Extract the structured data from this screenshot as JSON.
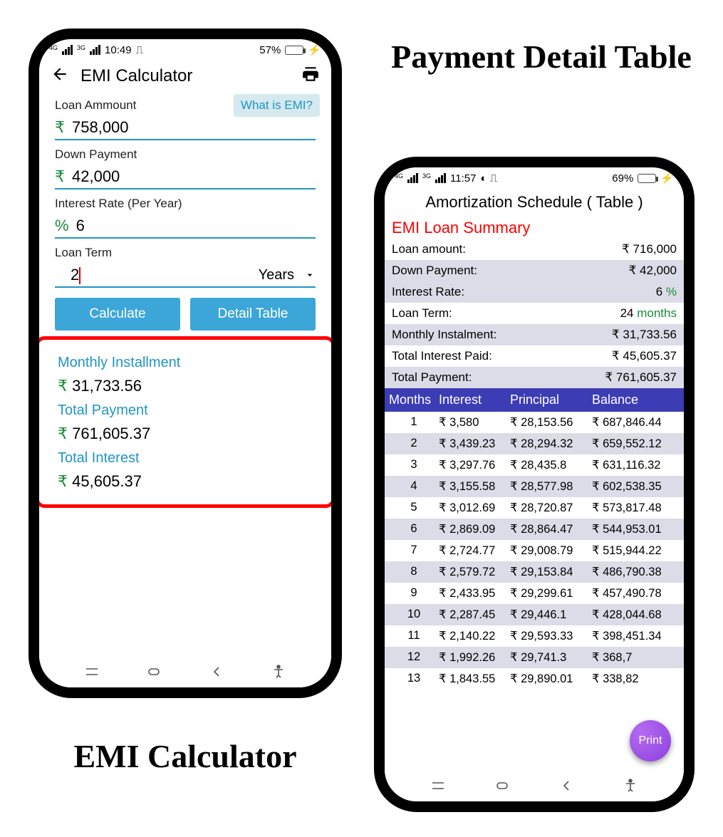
{
  "captions": {
    "right": "Payment Detail Table",
    "left": "EMI Calculator"
  },
  "phone1": {
    "status": {
      "time": "10:49",
      "net": "4G",
      "net2": "3G",
      "battery_pct": "57%",
      "battery_fill": 57
    },
    "appbar": {
      "title": "EMI Calculator"
    },
    "form": {
      "loan_label": "Loan Ammount",
      "what_is_emi": "What is EMI?",
      "loan_value": "758,000",
      "down_label": "Down Payment",
      "down_value": "42,000",
      "rate_label": "Interest Rate (Per Year)",
      "rate_value": "6",
      "term_label": "Loan Term",
      "term_value": "2",
      "term_unit": "Years",
      "rupee": "₹",
      "percent": "%"
    },
    "buttons": {
      "calculate": "Calculate",
      "detail": "Detail Table"
    },
    "results": {
      "mi_label": "Monthly Installment",
      "mi_value": "31,733.56",
      "tp_label": "Total Payment",
      "tp_value": "761,605.37",
      "ti_label": "Total Interest",
      "ti_value": "45,605.37",
      "rupee": "₹"
    }
  },
  "phone2": {
    "status": {
      "time": "11:57",
      "net": "4G",
      "net2": "3G",
      "battery_pct": "69%",
      "battery_fill": 69
    },
    "title": "Amortization Schedule ( Table )",
    "summary_title": "EMI Loan Summary",
    "summary": {
      "loan_l": "Loan amount:",
      "loan_v": "₹ 716,000",
      "dp_l": "Down Payment:",
      "dp_v": "₹ 42,000",
      "rate_l": "Interest Rate:",
      "rate_v": "6",
      "rate_u": " %",
      "term_l": "Loan Term:",
      "term_v": "24",
      "term_u": " months",
      "mi_l": "Monthly Instalment:",
      "mi_v": "₹ 31,733.56",
      "tip_l": "Total Interest Paid:",
      "tip_v": "₹ 45,605.37",
      "tp_l": "Total Payment:",
      "tp_v": "₹ 761,605.37"
    },
    "table": {
      "headers": {
        "m": "Months",
        "i": "Interest",
        "p": "Principal",
        "b": "Balance"
      },
      "rows": [
        {
          "m": "1",
          "i": "₹ 3,580",
          "p": "₹ 28,153.56",
          "b": "₹ 687,846.44"
        },
        {
          "m": "2",
          "i": "₹ 3,439.23",
          "p": "₹ 28,294.32",
          "b": "₹ 659,552.12"
        },
        {
          "m": "3",
          "i": "₹ 3,297.76",
          "p": "₹ 28,435.8",
          "b": "₹ 631,116.32"
        },
        {
          "m": "4",
          "i": "₹ 3,155.58",
          "p": "₹ 28,577.98",
          "b": "₹ 602,538.35"
        },
        {
          "m": "5",
          "i": "₹ 3,012.69",
          "p": "₹ 28,720.87",
          "b": "₹ 573,817.48"
        },
        {
          "m": "6",
          "i": "₹ 2,869.09",
          "p": "₹ 28,864.47",
          "b": "₹ 544,953.01"
        },
        {
          "m": "7",
          "i": "₹ 2,724.77",
          "p": "₹ 29,008.79",
          "b": "₹ 515,944.22"
        },
        {
          "m": "8",
          "i": "₹ 2,579.72",
          "p": "₹ 29,153.84",
          "b": "₹ 486,790.38"
        },
        {
          "m": "9",
          "i": "₹ 2,433.95",
          "p": "₹ 29,299.61",
          "b": "₹ 457,490.78"
        },
        {
          "m": "10",
          "i": "₹ 2,287.45",
          "p": "₹ 29,446.1",
          "b": "₹ 428,044.68"
        },
        {
          "m": "11",
          "i": "₹ 2,140.22",
          "p": "₹ 29,593.33",
          "b": "₹ 398,451.34"
        },
        {
          "m": "12",
          "i": "₹ 1,992.26",
          "p": "₹ 29,741.3",
          "b": "₹ 368,7"
        },
        {
          "m": "13",
          "i": "₹ 1,843.55",
          "p": "₹ 29,890.01",
          "b": "₹ 338,82"
        }
      ]
    },
    "fab": "Print"
  }
}
